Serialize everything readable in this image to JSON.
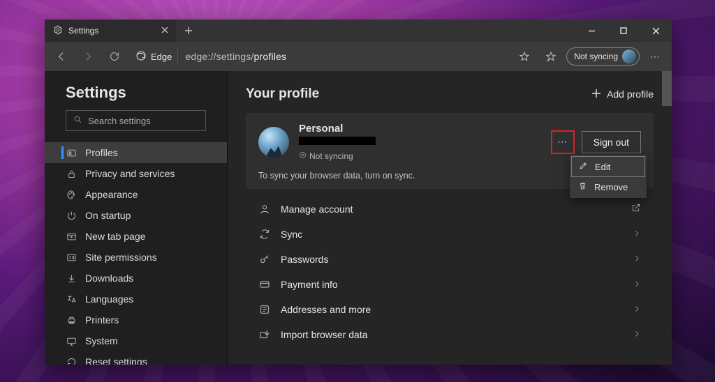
{
  "titlebar": {
    "tab_title": "Settings"
  },
  "urlbar": {
    "edge_label": "Edge",
    "url_prefix": "edge://settings/",
    "url_path": "profiles",
    "sync_status": "Not syncing"
  },
  "sidebar": {
    "heading": "Settings",
    "search_placeholder": "Search settings",
    "items": [
      {
        "label": "Profiles",
        "icon": "profile-card-icon",
        "active": true
      },
      {
        "label": "Privacy and services",
        "icon": "lock-icon"
      },
      {
        "label": "Appearance",
        "icon": "palette-icon"
      },
      {
        "label": "On startup",
        "icon": "power-icon"
      },
      {
        "label": "New tab page",
        "icon": "newtab-icon"
      },
      {
        "label": "Site permissions",
        "icon": "permissions-icon"
      },
      {
        "label": "Downloads",
        "icon": "download-icon"
      },
      {
        "label": "Languages",
        "icon": "language-icon"
      },
      {
        "label": "Printers",
        "icon": "printer-icon"
      },
      {
        "label": "System",
        "icon": "system-icon"
      },
      {
        "label": "Reset settings",
        "icon": "reset-icon"
      }
    ]
  },
  "main": {
    "heading": "Your profile",
    "add_profile": "Add profile",
    "profile": {
      "name": "Personal",
      "sync_status": "Not syncing",
      "signout": "Sign out",
      "sync_message": "To sync your browser data, turn on sync."
    },
    "context_menu": {
      "edit": "Edit",
      "remove": "Remove"
    },
    "rows": [
      {
        "label": "Manage account",
        "icon": "person-icon",
        "action": "external"
      },
      {
        "label": "Sync",
        "icon": "sync-icon",
        "action": "chevron"
      },
      {
        "label": "Passwords",
        "icon": "key-icon",
        "action": "chevron"
      },
      {
        "label": "Payment info",
        "icon": "card-icon",
        "action": "chevron"
      },
      {
        "label": "Addresses and more",
        "icon": "address-icon",
        "action": "chevron"
      },
      {
        "label": "Import browser data",
        "icon": "import-icon",
        "action": "chevron"
      }
    ]
  }
}
